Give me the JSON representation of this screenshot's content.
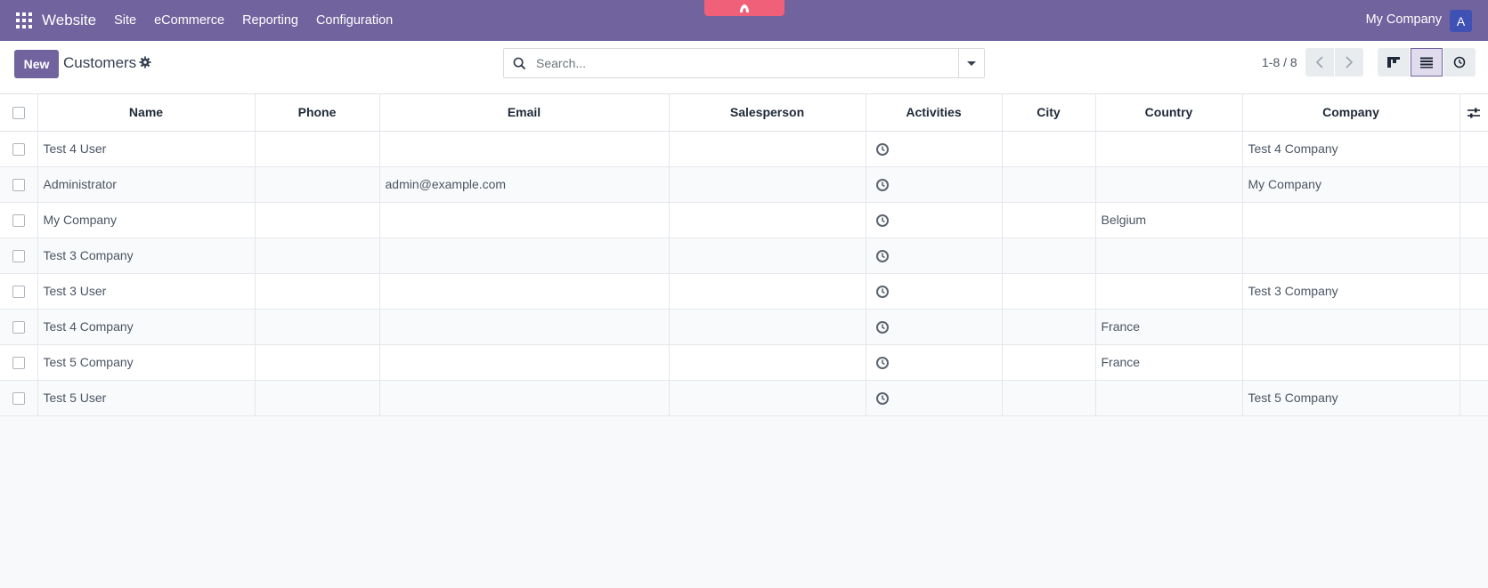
{
  "navbar": {
    "brand": "Website",
    "menu": [
      "Site",
      "eCommerce",
      "Reporting",
      "Configuration"
    ],
    "company": "My Company",
    "avatar_initial": "A",
    "accent_color": "#71639e"
  },
  "control_panel": {
    "new_label": "New",
    "title": "Customers",
    "search_placeholder": "Search...",
    "pager": "1-8 / 8"
  },
  "table": {
    "columns": [
      "Name",
      "Phone",
      "Email",
      "Salesperson",
      "Activities",
      "City",
      "Country",
      "Company"
    ],
    "rows": [
      {
        "name": "Test 4 User",
        "phone": "",
        "email": "",
        "salesperson": "",
        "city": "",
        "country": "",
        "company": "Test 4 Company"
      },
      {
        "name": "Administrator",
        "phone": "",
        "email": "admin@example.com",
        "salesperson": "",
        "city": "",
        "country": "",
        "company": "My Company"
      },
      {
        "name": "My Company",
        "phone": "",
        "email": "",
        "salesperson": "",
        "city": "",
        "country": "Belgium",
        "company": ""
      },
      {
        "name": "Test 3 Company",
        "phone": "",
        "email": "",
        "salesperson": "",
        "city": "",
        "country": "",
        "company": ""
      },
      {
        "name": "Test 3 User",
        "phone": "",
        "email": "",
        "salesperson": "",
        "city": "",
        "country": "",
        "company": "Test 3 Company"
      },
      {
        "name": "Test 4 Company",
        "phone": "",
        "email": "",
        "salesperson": "",
        "city": "",
        "country": "France",
        "company": ""
      },
      {
        "name": "Test 5 Company",
        "phone": "",
        "email": "",
        "salesperson": "",
        "city": "",
        "country": "France",
        "company": ""
      },
      {
        "name": "Test 5 User",
        "phone": "",
        "email": "",
        "salesperson": "",
        "city": "",
        "country": "",
        "company": "Test 5 Company"
      }
    ]
  }
}
